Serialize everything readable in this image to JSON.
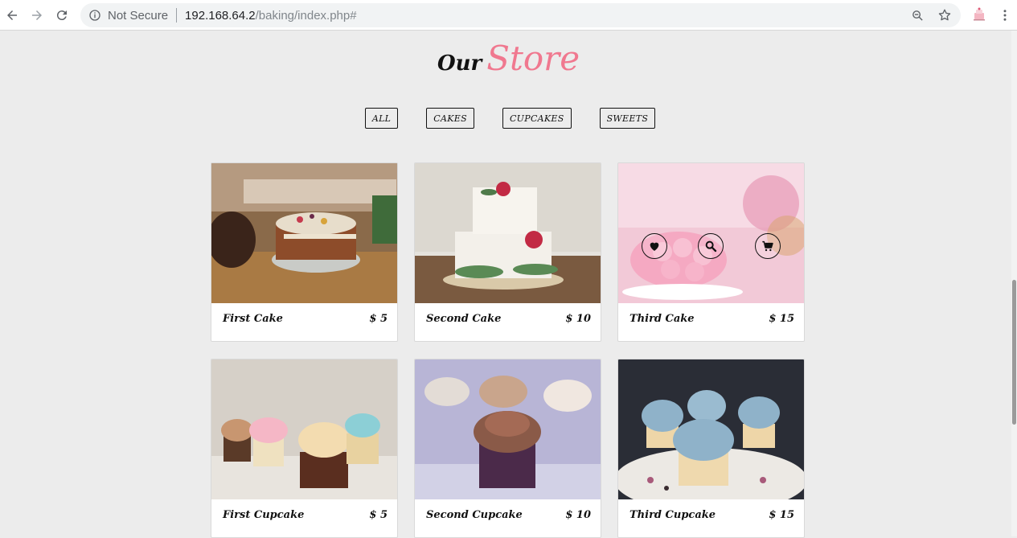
{
  "browser": {
    "security_label": "Not Secure",
    "url_host": "192.168.64.2",
    "url_path": "/baking/index.php#",
    "icons": [
      "back-arrow-icon",
      "forward-arrow-icon",
      "reload-icon",
      "info-icon",
      "zoom-icon",
      "star-icon",
      "extension-icon",
      "menu-icon"
    ]
  },
  "header": {
    "title_part1": "Our",
    "title_part2": "Store",
    "accent_color": "#f0788f"
  },
  "filters": [
    {
      "label": "ALL"
    },
    {
      "label": "CAKES"
    },
    {
      "label": "CUPCAKES"
    },
    {
      "label": "SWEETS"
    }
  ],
  "products": [
    {
      "name": "First Cake",
      "price": "$ 5"
    },
    {
      "name": "Second Cake",
      "price": "$ 10"
    },
    {
      "name": "Third Cake",
      "price": "$ 15"
    },
    {
      "name": "First Cupcake",
      "price": "$ 5"
    },
    {
      "name": "Second Cupcake",
      "price": "$ 10"
    },
    {
      "name": "Third Cupcake",
      "price": "$ 15"
    }
  ],
  "hover_overlay_icons": [
    "heart-icon",
    "search-icon",
    "cart-icon"
  ]
}
